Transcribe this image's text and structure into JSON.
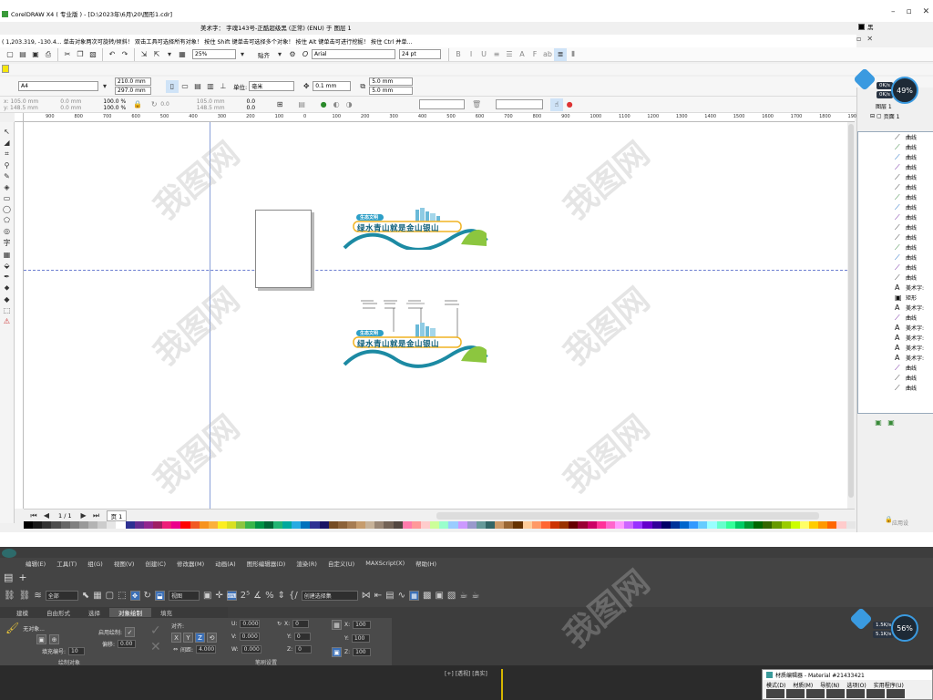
{
  "corel": {
    "title": "CorelDRAW X4 ( 专业版 ) - [D:\\2023年\\6月\\20\\图形1.cdr]",
    "status_object": "美术字： 字魂143号-正酷超级黑 (正常) (ENU) 于 图层 1",
    "fill_label": "黑",
    "hint_text": "( 1,203.319, -130.4... 单击对象两次可旋转/倾斜！ 双击工具可选择所有对象！ 按住 Shift 键单击可选择多个对象！ 按住 Alt 键单击可进行挖掘！ 按住 Ctrl 并单...",
    "zoom": "25%",
    "snap_label": "贴齐",
    "font_name": "Arial",
    "font_size": "24 pt",
    "page_size": "A4",
    "width": "210.0 mm",
    "height": "297.0 mm",
    "unit_label": "单位:",
    "unit_value": "毫米",
    "nudge": "0.1 mm",
    "dup_x": "5.0 mm",
    "dup_y": "5.0 mm",
    "pos_x": "105.0 mm",
    "pos_y": "148.5 mm",
    "size_w": "0.0 mm",
    "size_h": "0.0 mm",
    "scale_w": "100.0",
    "scale_h": "100.0",
    "pct": "%",
    "rotate": "0.0",
    "center_x": "105.0 mm",
    "center_y": "148.5 mm",
    "skew_x": "0.0",
    "skew_y": "0.0",
    "ruler_ticks": [
      "900",
      "800",
      "700",
      "600",
      "500",
      "400",
      "300",
      "200",
      "100",
      "0",
      "100",
      "200",
      "300",
      "400",
      "500",
      "600",
      "700",
      "800",
      "900",
      "1000",
      "1100",
      "1200",
      "1300",
      "1400",
      "1500",
      "1600",
      "1700",
      "1800",
      "1900"
    ],
    "page_nav": "1 / 1",
    "page_tab": "页 1",
    "artwork_text": "绿水青山就是金山银山",
    "artwork_badge": "生态文明",
    "objmgr_layer": "图层 1",
    "objmgr_page": "页面 1",
    "tree": [
      {
        "icon": "curve",
        "label": "曲线"
      },
      {
        "icon": "curve",
        "label": "曲线"
      },
      {
        "icon": "curve",
        "label": "曲线"
      },
      {
        "icon": "curve",
        "label": "曲线"
      },
      {
        "icon": "curve",
        "label": "曲线"
      },
      {
        "icon": "curve",
        "label": "曲线"
      },
      {
        "icon": "curve",
        "label": "曲线"
      },
      {
        "icon": "curve",
        "label": "曲线"
      },
      {
        "icon": "curve",
        "label": "曲线"
      },
      {
        "icon": "curve",
        "label": "曲线"
      },
      {
        "icon": "curve",
        "label": "曲线"
      },
      {
        "icon": "curve",
        "label": "曲线"
      },
      {
        "icon": "curve",
        "label": "曲线"
      },
      {
        "icon": "curve",
        "label": "曲线"
      },
      {
        "icon": "curve",
        "label": "曲线"
      },
      {
        "icon": "text",
        "label": "美术字:"
      },
      {
        "icon": "rect",
        "label": "矩形"
      },
      {
        "icon": "text",
        "label": "美术字:"
      },
      {
        "icon": "curve",
        "label": "曲线"
      },
      {
        "icon": "text",
        "label": "美术字:"
      },
      {
        "icon": "text",
        "label": "美术字:"
      },
      {
        "icon": "text",
        "label": "美术字:"
      },
      {
        "icon": "text",
        "label": "美术字:"
      },
      {
        "icon": "curve",
        "label": "曲线"
      },
      {
        "icon": "curve",
        "label": "曲线"
      },
      {
        "icon": "curve",
        "label": "曲线"
      }
    ],
    "apply_label": "应用设",
    "net_up": "0K/s",
    "net_down": "0K/s",
    "net_pct": "49%"
  },
  "max": {
    "menu": [
      "编辑(E)",
      "工具(T)",
      "组(G)",
      "视图(V)",
      "创建(C)",
      "修改器(M)",
      "动画(A)",
      "图形编辑器(D)",
      "渲染(R)",
      "自定义(U)",
      "MAXScript(X)",
      "帮助(H)"
    ],
    "select_filter": "全部",
    "ref_coord": "视图",
    "named_set": "创建选择集",
    "tabs": [
      "建模",
      "自由形式",
      "选择",
      "对象绘制",
      "填充"
    ],
    "active_tab": "对象绘制",
    "paint_on": "无对象...",
    "fill_num_label": "填充编号:",
    "fill_num": "10",
    "enable_label": "启用绘制:",
    "offset_label": "偏移:",
    "offset_val": "0.00",
    "align_label": "对齐:",
    "spacing_label": "间距:",
    "spacing_val": "4.000",
    "u_label": "U:",
    "u_val": "0.000",
    "v_label": "V:",
    "v_val": "0.000",
    "w_label": "W:",
    "w_val": "0.000",
    "x_label": "X:",
    "x_val": "0",
    "y_label": "Y:",
    "y_val": "0",
    "z_label": "Z:",
    "z_val": "0",
    "sx_val": "100",
    "sy_val": "100",
    "sz_val": "100",
    "section_paint": "绘制对象",
    "section_brush": "笔刷设置",
    "viewport_label": "[+] [透视] [真实]",
    "mat_title": "材质编辑器 - Material #21433421",
    "mat_menu": [
      "模式(D)",
      "材质(M)",
      "导航(N)",
      "选项(O)",
      "实用程序(U)"
    ],
    "net_up": "1.5K/s",
    "net_down": "5.1K/s",
    "net_pct": "56%"
  },
  "palette": [
    "#000000",
    "#1a1a1a",
    "#333333",
    "#4d4d4d",
    "#666666",
    "#808080",
    "#999999",
    "#b3b3b3",
    "#cccccc",
    "#e6e6e6",
    "#ffffff",
    "#2e3192",
    "#662d91",
    "#92278f",
    "#9e1f63",
    "#ed1e79",
    "#ec008c",
    "#ff0000",
    "#f15a24",
    "#f7931e",
    "#fbb03b",
    "#fcee21",
    "#d9e021",
    "#8cc63f",
    "#39b54a",
    "#009245",
    "#006837",
    "#22b573",
    "#00a99d",
    "#29abe2",
    "#0071bc",
    "#2e3192",
    "#1b1464",
    "#754c24",
    "#8c6239",
    "#a67c52",
    "#c69c6d",
    "#c7b299",
    "#998675",
    "#736357",
    "#534741",
    "#ff7bac",
    "#ff9999",
    "#ffcccc",
    "#ccff99",
    "#99ffcc",
    "#99ccff",
    "#cc99ff",
    "#9999cc",
    "#669999",
    "#336666",
    "#cc9966",
    "#996633",
    "#663300",
    "#ffcc99",
    "#ff9966",
    "#ff6633",
    "#cc3300",
    "#993300",
    "#660000",
    "#990033",
    "#cc0066",
    "#ff3399",
    "#ff66cc",
    "#ff99ff",
    "#cc66ff",
    "#9933ff",
    "#6600cc",
    "#330099",
    "#000066",
    "#003399",
    "#0066cc",
    "#3399ff",
    "#66ccff",
    "#99ffff",
    "#66ffcc",
    "#33ff99",
    "#00cc66",
    "#009933",
    "#006600",
    "#336600",
    "#669900",
    "#99cc00",
    "#ccff00",
    "#ffff66",
    "#ffcc00",
    "#ff9900",
    "#ff6600",
    "#ffcccc",
    "#e6e6e6"
  ],
  "watermark": "我图网"
}
